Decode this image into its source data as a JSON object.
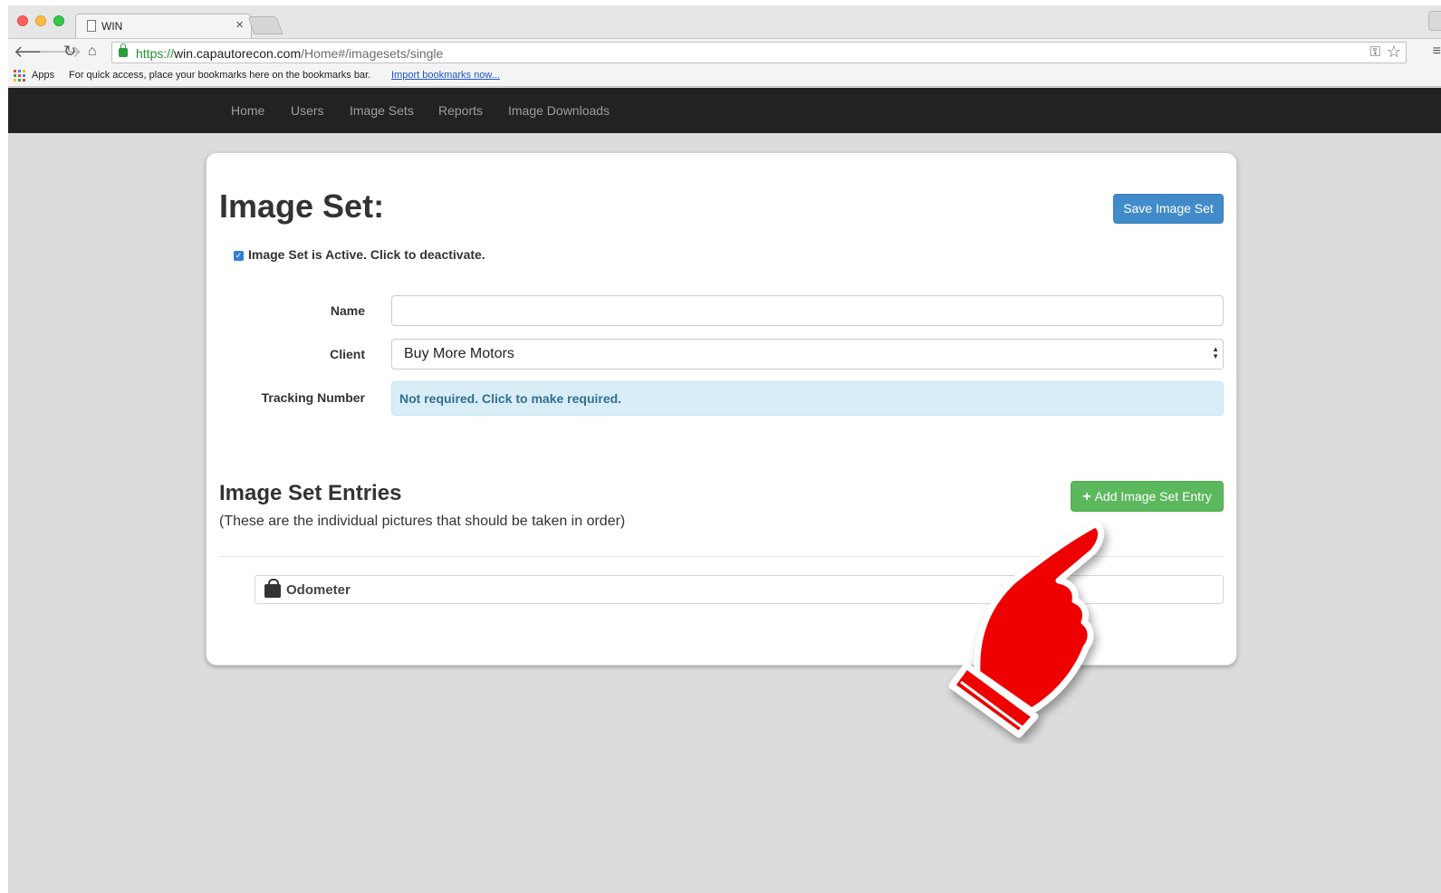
{
  "browser": {
    "tab_title": "WIN",
    "tab_close": "×",
    "url_scheme": "https://",
    "url_host": "win.capautorecon.com",
    "url_path": "/Home#/imagesets/single",
    "bookmarks": {
      "apps_label": "Apps",
      "message": "For quick access, place your bookmarks here on the bookmarks bar.",
      "import_link": "Import bookmarks now..."
    }
  },
  "nav": {
    "items": [
      "Home",
      "Users",
      "Image Sets",
      "Reports",
      "Image Downloads"
    ]
  },
  "form": {
    "title": "Image Set:",
    "save_label": "Save Image Set",
    "active_label": "Image Set is Active. Click to deactivate.",
    "name_label": "Name",
    "name_value": "",
    "client_label": "Client",
    "client_value": "Buy More Motors",
    "tracking_label": "Tracking Number",
    "tracking_text": "Not required. Click to make required."
  },
  "entries": {
    "title": "Image Set Entries",
    "subtitle": "(These are the individual pictures that should be taken in order)",
    "add_label": "Add Image Set Entry",
    "items": [
      {
        "label": "Odometer"
      }
    ]
  },
  "colors": {
    "navbar": "#222222",
    "primary": "#428bca",
    "success": "#5cb85c",
    "info_bg": "#d9edf7",
    "pointer": "#ee0000"
  }
}
